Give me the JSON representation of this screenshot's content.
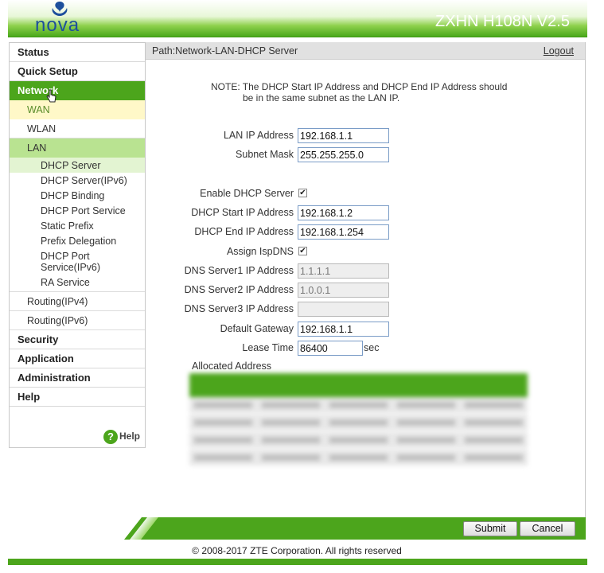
{
  "header": {
    "brand": "nova",
    "model": "ZXHN H108N V2.5"
  },
  "sidebar": {
    "status": "Status",
    "quick_setup": "Quick Setup",
    "network": "Network",
    "wan": "WAN",
    "wlan": "WLAN",
    "lan": "LAN",
    "lan_items": [
      "DHCP Server",
      "DHCP Server(IPv6)",
      "DHCP Binding",
      "DHCP Port Service",
      "Static Prefix",
      "Prefix Delegation",
      "DHCP Port Service(IPv6)",
      "RA Service"
    ],
    "routing_ipv4": "Routing(IPv4)",
    "routing_ipv6": "Routing(IPv6)",
    "security": "Security",
    "application": "Application",
    "administration": "Administration",
    "help_item": "Help",
    "help_link": "Help"
  },
  "path": {
    "text": "Path:Network-LAN-DHCP Server",
    "logout": "Logout"
  },
  "note": {
    "line1": "NOTE: The DHCP Start IP Address and DHCP End IP Address should",
    "line2": "be in the same subnet as the LAN IP."
  },
  "form": {
    "lan_ip_label": "LAN IP Address",
    "lan_ip": "192.168.1.1",
    "subnet_label": "Subnet Mask",
    "subnet": "255.255.255.0",
    "enable_dhcp_label": "Enable DHCP Server",
    "enable_dhcp": true,
    "start_ip_label": "DHCP Start IP Address",
    "start_ip": "192.168.1.2",
    "end_ip_label": "DHCP End IP Address",
    "end_ip": "192.168.1.254",
    "assign_isp_dns_label": "Assign IspDNS",
    "assign_isp_dns": true,
    "dns1_label": "DNS Server1 IP Address",
    "dns1": "1.1.1.1",
    "dns2_label": "DNS Server2 IP Address",
    "dns2": "1.0.0.1",
    "dns3_label": "DNS Server3 IP Address",
    "dns3": "",
    "gateway_label": "Default Gateway",
    "gateway": "192.168.1.1",
    "lease_label": "Lease Time",
    "lease": "86400",
    "lease_unit": "sec"
  },
  "allocated": {
    "title": "Allocated Address"
  },
  "buttons": {
    "submit": "Submit",
    "cancel": "Cancel"
  },
  "footer": {
    "copyright": "© 2008-2017 ZTE Corporation. All rights reserved"
  },
  "colors": {
    "accent": "#4ca51c",
    "brand_blue": "#1d4f9c"
  }
}
